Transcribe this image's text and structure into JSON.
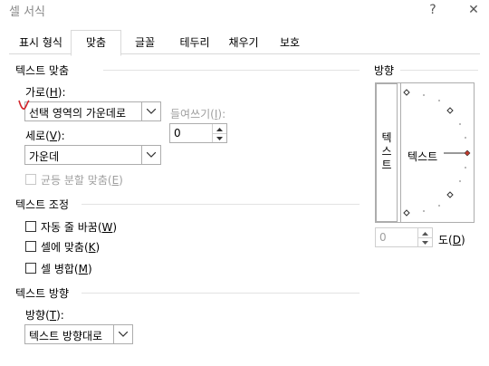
{
  "window": {
    "title": "셀 서식",
    "help": "?",
    "close": "✕"
  },
  "tabs": [
    "표시 형식",
    "맞춤",
    "글꼴",
    "테두리",
    "채우기",
    "보호"
  ],
  "alignment": {
    "section": "텍스트 맞춤",
    "horizontal_label": "가로(",
    "horizontal_key": "H",
    "horizontal_value": "선택 영역의 가운데로",
    "indent_label": "들여쓰기(",
    "indent_key": "I",
    "indent_value": "0",
    "vertical_label": "세로(",
    "vertical_key": "V",
    "vertical_value": "가운데",
    "justify_label": "균등 분할 맞춤(",
    "justify_key": "E"
  },
  "control": {
    "section": "텍스트 조정",
    "wrap_label": "자동 줄 바꿈(",
    "wrap_key": "W",
    "shrink_label": "셀에 맞춤(",
    "shrink_key": "K",
    "merge_label": "셀 병합(",
    "merge_key": "M"
  },
  "direction": {
    "section": "텍스트 방향",
    "label": "방향(",
    "key": "T",
    "value": "텍스트 방향대로"
  },
  "orientation": {
    "section": "방향",
    "vertical_text": [
      "텍",
      "스",
      "트"
    ],
    "horizontal_text": "텍스트",
    "degrees_value": "0",
    "degrees_label": "도(",
    "degrees_key": "D",
    "marker_color": "#c0392b"
  },
  "closing_paren": ")",
  "closing_paren_colon": "):"
}
